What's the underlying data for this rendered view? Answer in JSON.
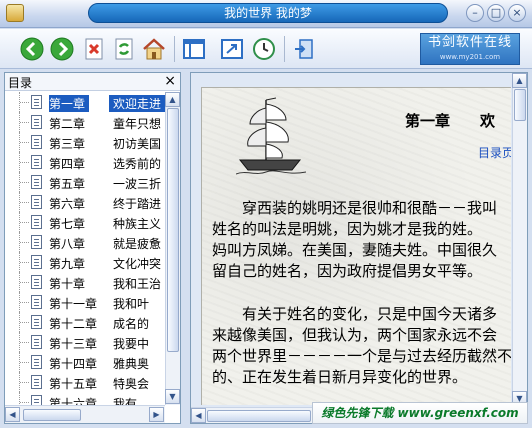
{
  "window": {
    "title": "我的世界  我的梦",
    "minimize_glyph": "–",
    "maximize_glyph": "□",
    "close_glyph": "×"
  },
  "toolbar": {
    "buttons": [
      {
        "name": "back-icon",
        "color": "#3aa83a"
      },
      {
        "name": "forward-icon",
        "color": "#3aa83a"
      },
      {
        "name": "stop-icon",
        "color": "#d93a2b"
      },
      {
        "name": "refresh-icon",
        "color": "#3aa83a"
      },
      {
        "name": "home-icon",
        "color": "#d48a2a"
      },
      {
        "name": "toc-view-icon",
        "color": "#2d6fc4"
      },
      {
        "name": "fullscreen-icon",
        "color": "#2d6fc4"
      },
      {
        "name": "auto-scroll-icon",
        "color": "#2f8f4a"
      },
      {
        "name": "exit-icon",
        "color": "#2d6fc4"
      }
    ],
    "logo_line1": "书剑软件在线",
    "logo_line2": "www.my201.com"
  },
  "toc": {
    "header": "目录",
    "close_glyph": "×",
    "items": [
      {
        "chapter": "第一章",
        "name": "欢迎走进",
        "selected": true
      },
      {
        "chapter": "第二章",
        "name": "童年只想"
      },
      {
        "chapter": "第三章",
        "name": "初访美国"
      },
      {
        "chapter": "第四章",
        "name": "选秀前的"
      },
      {
        "chapter": "第五章",
        "name": "一波三折"
      },
      {
        "chapter": "第六章",
        "name": "终于踏进"
      },
      {
        "chapter": "第七章",
        "name": "种族主义"
      },
      {
        "chapter": "第八章",
        "name": "就是疲惫"
      },
      {
        "chapter": "第九章",
        "name": "文化冲突"
      },
      {
        "chapter": "第十章",
        "name": "我和王治"
      },
      {
        "chapter": "第十一章",
        "name": "我和叶"
      },
      {
        "chapter": "第十二章",
        "name": "成名的"
      },
      {
        "chapter": "第十三章",
        "name": "我要中"
      },
      {
        "chapter": "第十四章",
        "name": "雅典奥"
      },
      {
        "chapter": "第十五章",
        "name": "特奥会"
      },
      {
        "chapter": "第十六章",
        "name": "我有"
      }
    ]
  },
  "content": {
    "chapter_title": "第一章　　欢",
    "toc_link": "目录页",
    "paragraph1": [
      "　　穿西装的姚明还是很帅和很酷－－我叫",
      "姓名的叫法是明姚，因为姚才是我的姓。",
      "妈叫方凤娣。在美国，妻随夫姓。中国很久",
      "留自己的姓名，因为政府提倡男女平等。"
    ],
    "paragraph2": [
      "　　有关于姓名的变化，只是中国今天诸多",
      "来越像美国，但我认为，两个国家永远不会",
      "两个世界里－－－－一个是与过去经历截然不",
      "的、正在发生着日新月异变化的世界。"
    ]
  },
  "watermark": {
    "text": "绿色先锋下载 www.greenxf.com"
  }
}
